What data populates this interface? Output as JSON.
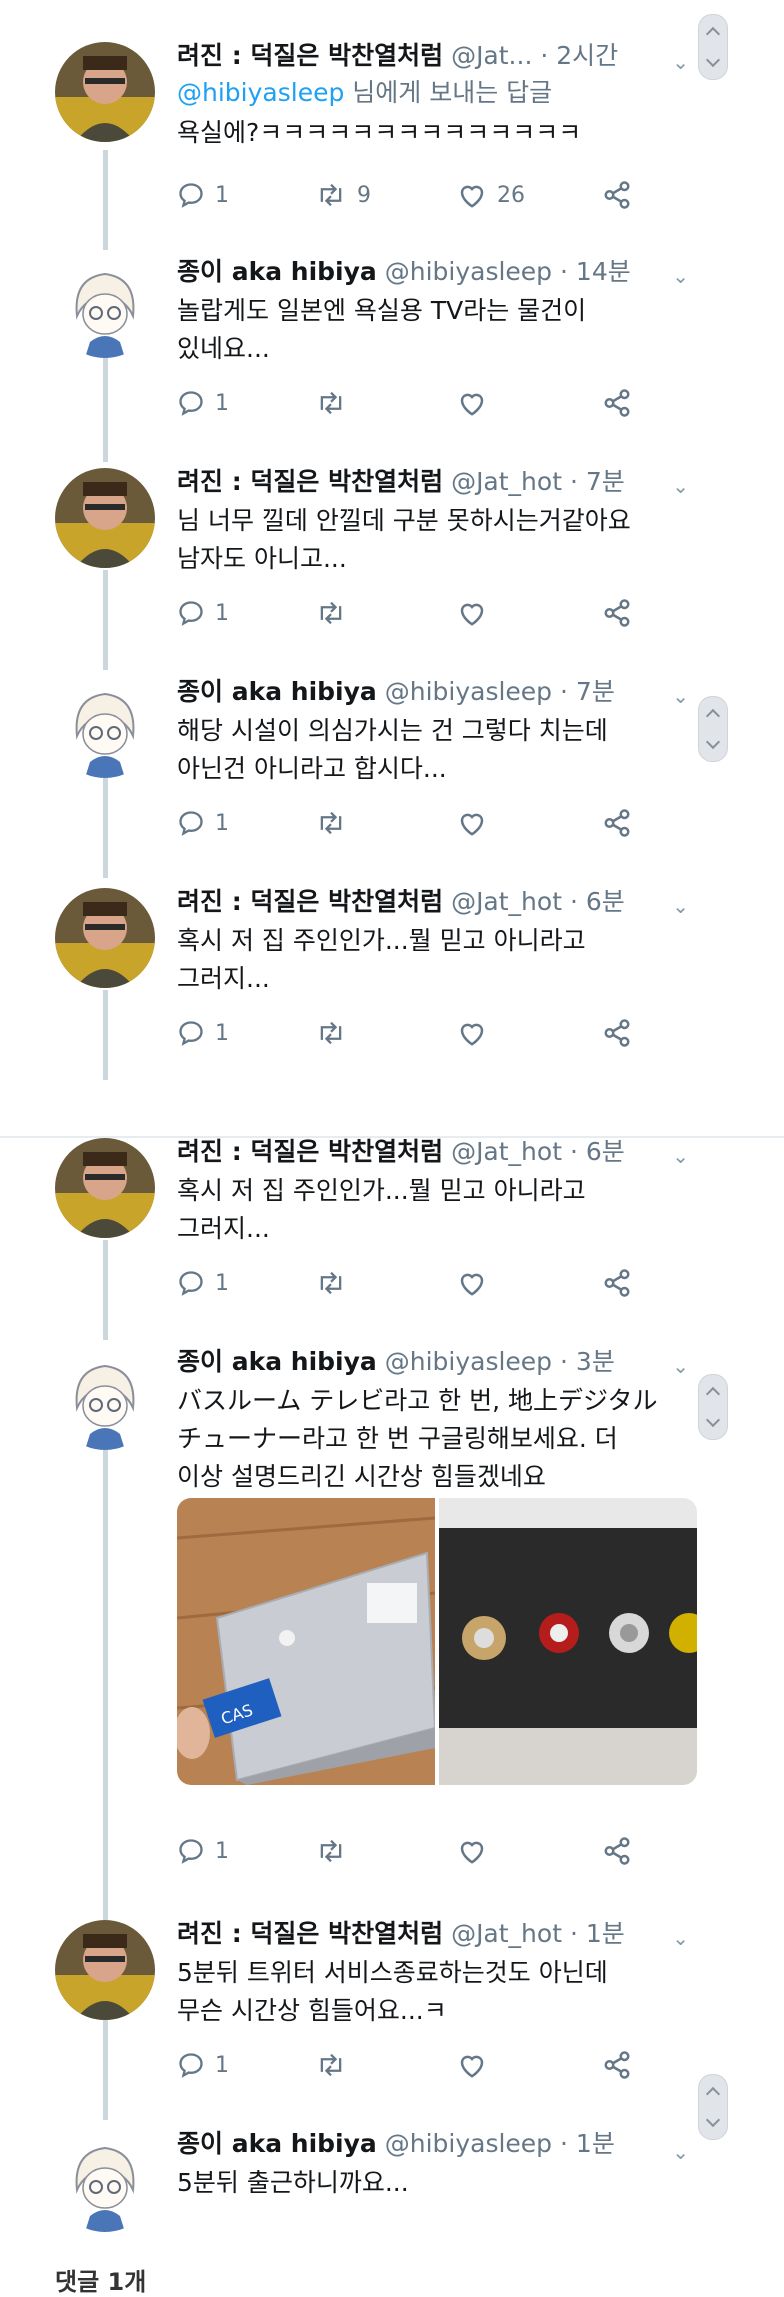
{
  "tweets": [
    {
      "name": "려진 : 덕질은 박찬열처럼",
      "handle": "@Jat...",
      "time": "· 2시간",
      "reply_mention": "@hibiyasleep",
      "reply_suffix": " 님에게 보내는 답글",
      "text": "욕실에?ㅋㅋㅋㅋㅋㅋㅋㅋㅋㅋㅋㅋㅋㅋ",
      "replies": "1",
      "retweets": "9",
      "likes": "26"
    },
    {
      "name": "종이 aka hibiya",
      "handle": "@hibiyasleep",
      "time": "· 14분",
      "text": "놀랍게도 일본엔 욕실용 TV라는 물건이\n있네요...",
      "replies": "1",
      "retweets": "",
      "likes": ""
    },
    {
      "name": "려진 : 덕질은 박찬열처럼",
      "handle": "@Jat_hot",
      "time": "· 7분",
      "text": "님 너무 낄데 안낄데 구분 못하시는거같아요\n남자도 아니고...",
      "replies": "1",
      "retweets": "",
      "likes": ""
    },
    {
      "name": "종이 aka hibiya",
      "handle": "@hibiyasleep",
      "time": "· 7분",
      "text": "해당 시설이 의심가시는 건 그렇다 치는데\n아닌건 아니라고 합시다...",
      "replies": "1",
      "retweets": "",
      "likes": ""
    },
    {
      "name": "려진 : 덕질은 박찬열처럼",
      "handle": "@Jat_hot",
      "time": "· 6분",
      "text": "혹시 저 집 주인인가...뭘 믿고 아니라고\n그러지...",
      "replies": "1",
      "retweets": "",
      "likes": ""
    },
    {
      "name": "려진 : 덕질은 박찬열처럼",
      "handle": "@Jat_hot",
      "time": "· 6분",
      "text": "혹시 저 집 주인인가...뭘 믿고 아니라고\n그러지...",
      "replies": "1",
      "retweets": "",
      "likes": ""
    },
    {
      "name": "종이 aka hibiya",
      "handle": "@hibiyasleep",
      "time": "· 3분",
      "text": "バスルーム テレビ라고 한 번, 地上デジタル\nチューナー라고 한 번 구글링해보세요. 더\n이상 설명드리긴 시간상 힘들겠네요",
      "replies": "1",
      "retweets": "",
      "likes": "",
      "media_card_text": "CAS"
    },
    {
      "name": "려진 : 덕질은 박찬열처럼",
      "handle": "@Jat_hot",
      "time": "· 1분",
      "text": "5분뒤 트위터 서비스종료하는것도 아닌데\n무슨 시간상 힘들어요...ㅋ",
      "replies": "1",
      "retweets": "",
      "likes": ""
    },
    {
      "name": "종이 aka hibiya",
      "handle": "@hibiyasleep",
      "time": "· 1분",
      "text": "5분뒤 출근하니까요..."
    }
  ],
  "footer_label": "댓글 1개",
  "icons": {
    "reply": "reply-icon",
    "retweet": "retweet-icon",
    "like": "heart-icon",
    "share": "share-icon",
    "caret": "chevron-down-icon"
  },
  "colors": {
    "link": "#1da1f2",
    "muted": "#657786",
    "thread_line": "#ccd6dd"
  }
}
